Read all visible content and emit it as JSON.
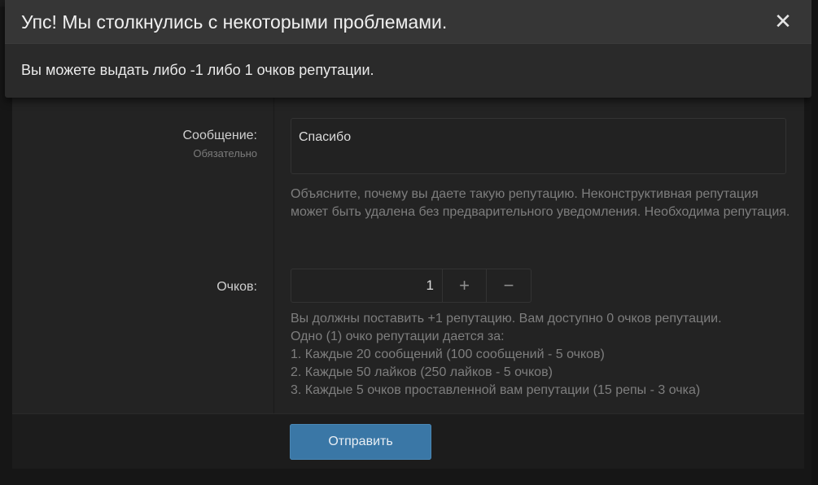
{
  "error": {
    "title": "Упс! Мы столкнулись с некоторыми проблемами.",
    "message": "Вы можете выдать либо -1 либо 1 очков репутации.",
    "close_icon": "close-icon"
  },
  "form": {
    "message_label": "Сообщение:",
    "message_required": "Обязательно",
    "message_value": "Спасибо",
    "message_explain": "Объясните, почему вы даете такую репутацию. Неконструктивная репутация может быть удалена без предварительного уведомления. Необходима репутация.",
    "points_label": "Очков:",
    "points_value": "1",
    "plus_symbol": "+",
    "minus_symbol": "−",
    "points_explain": [
      "Вы должны поставить +1 репутацию. Вам доступно 0 очков репутации.",
      "Одно (1) очко репутации дается за:",
      "1. Каждые 20 сообщений (100 сообщений - 5 очков)",
      "2. Каждые 50 лайков (250 лайков - 5 очков)",
      "3. Каждые 5 очков проставленной вам репутации (15 репы - 3 очка)"
    ],
    "submit_label": "Отправить"
  },
  "colors": {
    "accent": "#3a77a6",
    "background": "#161616",
    "overlay": "#2a2a2a"
  }
}
